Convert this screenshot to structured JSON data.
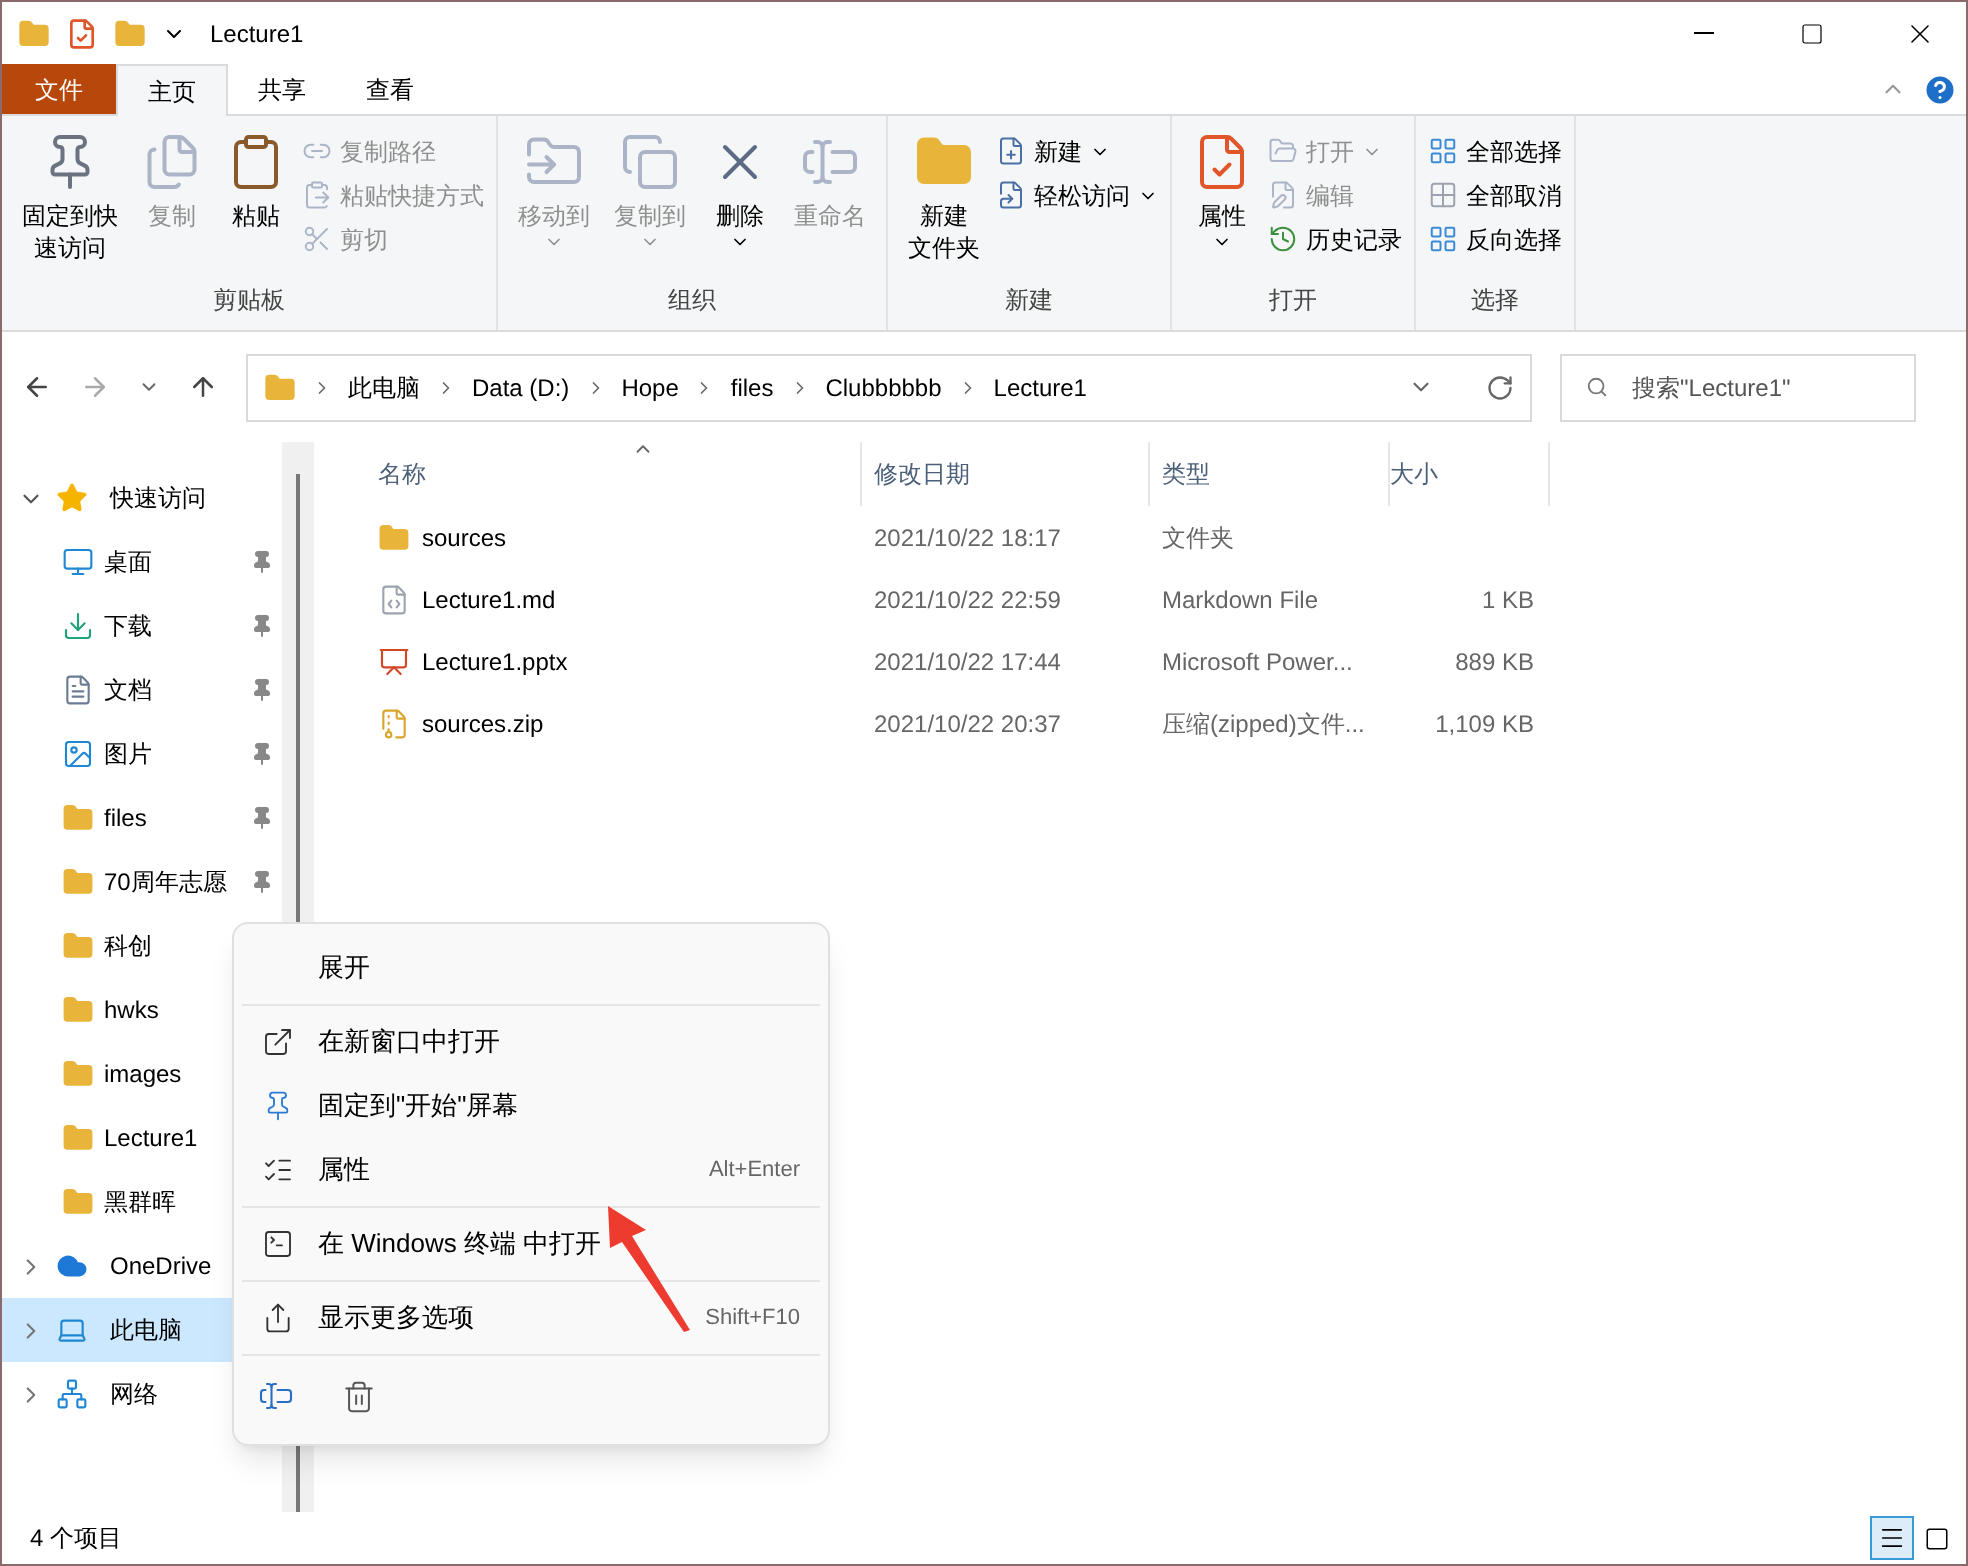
{
  "window": {
    "title": "Lecture1"
  },
  "ribbon_tabs": [
    {
      "label": "文件",
      "kind": "file",
      "selected": false
    },
    {
      "label": "主页",
      "kind": "tab",
      "selected": true
    },
    {
      "label": "共享",
      "kind": "tab",
      "selected": false
    },
    {
      "label": "查看",
      "kind": "tab",
      "selected": false
    }
  ],
  "ribbon_groups": [
    {
      "label": "剪贴板",
      "items": [
        {
          "lines": [
            "固定到快",
            "速访问"
          ],
          "kind": "large",
          "disabled": false,
          "dropdown": false
        },
        {
          "lines": [
            "复制"
          ],
          "kind": "large",
          "disabled": true,
          "dropdown": false
        },
        {
          "lines": [
            "粘贴"
          ],
          "kind": "large",
          "disabled": false,
          "dropdown": false
        },
        {
          "label": "复制路径",
          "kind": "small",
          "disabled": true,
          "dropdown": false
        },
        {
          "label": "粘贴快捷方式",
          "kind": "small",
          "disabled": true,
          "dropdown": false
        },
        {
          "label": "剪切",
          "kind": "small",
          "disabled": true,
          "dropdown": false
        }
      ]
    },
    {
      "label": "组织",
      "items": [
        {
          "lines": [
            "移动到"
          ],
          "kind": "large",
          "disabled": true,
          "dropdown": true
        },
        {
          "lines": [
            "复制到"
          ],
          "kind": "large",
          "disabled": true,
          "dropdown": true
        },
        {
          "lines": [
            "删除"
          ],
          "kind": "large",
          "disabled": false,
          "dropdown": true
        },
        {
          "lines": [
            "重命名"
          ],
          "kind": "large",
          "disabled": true,
          "dropdown": false
        }
      ]
    },
    {
      "label": "新建",
      "items": [
        {
          "lines": [
            "新建",
            "文件夹"
          ],
          "kind": "large",
          "disabled": false,
          "dropdown": false
        },
        {
          "label": "新建",
          "kind": "small",
          "disabled": false,
          "dropdown": true
        },
        {
          "label": "轻松访问",
          "kind": "small",
          "disabled": false,
          "dropdown": true
        }
      ]
    },
    {
      "label": "打开",
      "items": [
        {
          "lines": [
            "属性"
          ],
          "kind": "large",
          "disabled": false,
          "dropdown": true
        },
        {
          "label": "打开",
          "kind": "small",
          "disabled": true,
          "dropdown": true
        },
        {
          "label": "编辑",
          "kind": "small",
          "disabled": true,
          "dropdown": false
        },
        {
          "label": "历史记录",
          "kind": "small",
          "disabled": false,
          "dropdown": false
        }
      ]
    },
    {
      "label": "选择",
      "items": [
        {
          "label": "全部选择",
          "kind": "small",
          "disabled": false,
          "dropdown": false
        },
        {
          "label": "全部取消",
          "kind": "small",
          "disabled": false,
          "dropdown": false
        },
        {
          "label": "反向选择",
          "kind": "small",
          "disabled": false,
          "dropdown": false
        }
      ]
    }
  ],
  "breadcrumb": [
    "此电脑",
    "Data (D:)",
    "Hope",
    "files",
    "Clubbbbbb",
    "Lecture1"
  ],
  "search": {
    "placeholder": "搜索\"Lecture1\""
  },
  "nav_pane": [
    {
      "label": "快速访问",
      "kind": "star",
      "expanded": true,
      "selected": false,
      "children": [
        {
          "label": "桌面",
          "kind": "desktop",
          "pinned": true
        },
        {
          "label": "下载",
          "kind": "download",
          "pinned": true
        },
        {
          "label": "文档",
          "kind": "documents",
          "pinned": true
        },
        {
          "label": "图片",
          "kind": "pictures",
          "pinned": true
        },
        {
          "label": "files",
          "kind": "folder",
          "pinned": true
        },
        {
          "label": "70周年志愿",
          "kind": "folder",
          "pinned": true
        },
        {
          "label": "科创",
          "kind": "folder",
          "pinned": false
        },
        {
          "label": "hwks",
          "kind": "folder",
          "pinned": false
        },
        {
          "label": "images",
          "kind": "folder",
          "pinned": false
        },
        {
          "label": "Lecture1",
          "kind": "folder",
          "pinned": false
        },
        {
          "label": "黑群晖",
          "kind": "folder",
          "pinned": false
        }
      ]
    },
    {
      "label": "OneDrive",
      "kind": "cloud",
      "expanded": false,
      "selected": false
    },
    {
      "label": "此电脑",
      "kind": "computer",
      "expanded": false,
      "selected": true
    },
    {
      "label": "网络",
      "kind": "network",
      "expanded": false,
      "selected": false
    }
  ],
  "file_table": {
    "columns": [
      "名称",
      "修改日期",
      "类型",
      "大小"
    ],
    "rows": [
      {
        "name": "sources",
        "kind": "folder",
        "modified": "2021/10/22 18:17",
        "type": "文件夹"
      },
      {
        "name": "Lecture1.md",
        "kind": "markdown",
        "modified": "2021/10/22 22:59",
        "type": "Markdown File",
        "size": "1 KB"
      },
      {
        "name": "Lecture1.pptx",
        "kind": "slides",
        "modified": "2021/10/22 17:44",
        "type": "Microsoft Power...",
        "size": "889 KB"
      },
      {
        "name": "sources.zip",
        "kind": "zip",
        "modified": "2021/10/22 20:37",
        "type": "压缩(zipped)文件...",
        "size": "1,109 KB"
      }
    ]
  },
  "context_menu": {
    "sections": [
      [
        {
          "label": "展开"
        }
      ],
      [
        {
          "label": "在新窗口中打开"
        },
        {
          "label": "固定到\"开始\"屏幕"
        },
        {
          "label": "属性",
          "shortcut": "Alt+Enter"
        }
      ],
      [
        {
          "label": "在 Windows 终端 中打开"
        }
      ],
      [
        {
          "label": "显示更多选项",
          "shortcut": "Shift+F10"
        }
      ]
    ]
  },
  "status_bar": {
    "item_count": "4 个项目",
    "views": [
      {
        "kind": "details",
        "selected": true
      },
      {
        "kind": "large-icons",
        "selected": false
      }
    ]
  }
}
